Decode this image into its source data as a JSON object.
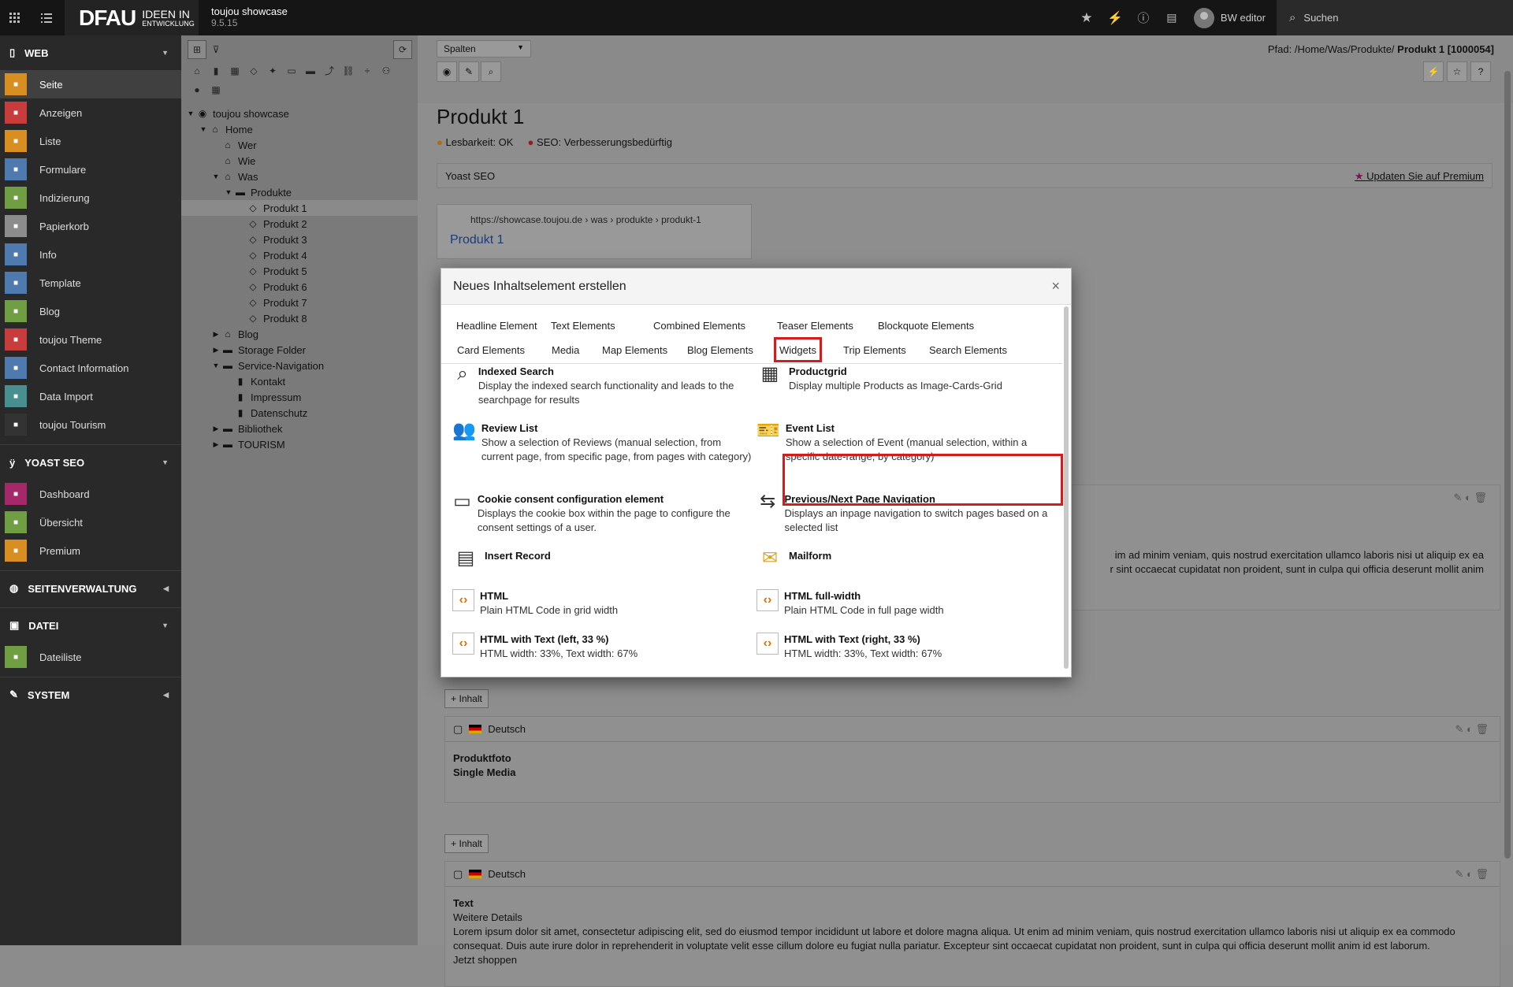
{
  "topbar": {
    "logo_main": "DFAU",
    "logo_sub1": "IDEEN IN",
    "logo_sub2": "ENTWICKLUNG",
    "site_name": "toujou showcase",
    "version": "9.5.15",
    "user": "BW editor",
    "search_placeholder": "Suchen"
  },
  "modules": {
    "web_label": "WEB",
    "web_items": [
      {
        "label": "Seite",
        "color": "#d98e21",
        "icon": "page-icon"
      },
      {
        "label": "Anzeigen",
        "color": "#c83c3c",
        "icon": "eye-icon"
      },
      {
        "label": "Liste",
        "color": "#d98e21",
        "icon": "list-icon"
      },
      {
        "label": "Formulare",
        "color": "#4f7ab0",
        "icon": "form-icon"
      },
      {
        "label": "Indizierung",
        "color": "#6f9e43",
        "icon": "index-icon"
      },
      {
        "label": "Papierkorb",
        "color": "#8c8c8c",
        "icon": "trash-icon"
      },
      {
        "label": "Info",
        "color": "#4f7ab0",
        "icon": "info-icon"
      },
      {
        "label": "Template",
        "color": "#4f7ab0",
        "icon": "template-icon"
      },
      {
        "label": "Blog",
        "color": "#6f9e43",
        "icon": "blog-icon"
      },
      {
        "label": "toujou Theme",
        "color": "#c83c3c",
        "icon": "fingerprint-icon"
      },
      {
        "label": "Contact Information",
        "color": "#4f7ab0",
        "icon": "contact-icon"
      },
      {
        "label": "Data Import",
        "color": "#4a8f8f",
        "icon": "cloud-icon"
      },
      {
        "label": "toujou Tourism",
        "color": "#333333",
        "icon": "plane-icon"
      }
    ],
    "yoast_label": "YOAST SEO",
    "yoast_items": [
      {
        "label": "Dashboard",
        "color": "#a4286a",
        "icon": "dashboard-icon"
      },
      {
        "label": "Übersicht",
        "color": "#6f9e43",
        "icon": "overview-icon"
      },
      {
        "label": "Premium",
        "color": "#d98e21",
        "icon": "trophy-icon"
      }
    ],
    "seiten_label": "SEITENVERWALTUNG",
    "datei_label": "DATEI",
    "datei_items": [
      {
        "label": "Dateiliste",
        "color": "#6f9e43",
        "icon": "files-icon"
      }
    ],
    "system_label": "SYSTEM"
  },
  "tree": [
    {
      "label": "toujou showcase",
      "depth": 0,
      "twisty": "▼",
      "icon": "◉"
    },
    {
      "label": "Home",
      "depth": 1,
      "twisty": "▼",
      "icon": "⌂"
    },
    {
      "label": "Wer",
      "depth": 2,
      "twisty": "",
      "icon": "⌂"
    },
    {
      "label": "Wie",
      "depth": 2,
      "twisty": "",
      "icon": "⌂"
    },
    {
      "label": "Was",
      "depth": 2,
      "twisty": "▼",
      "icon": "⌂"
    },
    {
      "label": "Produkte",
      "depth": 3,
      "twisty": "▼",
      "icon": "▬"
    },
    {
      "label": "Produkt 1",
      "depth": 4,
      "twisty": "",
      "icon": "◇",
      "selected": true
    },
    {
      "label": "Produkt 2",
      "depth": 4,
      "twisty": "",
      "icon": "◇"
    },
    {
      "label": "Produkt 3",
      "depth": 4,
      "twisty": "",
      "icon": "◇"
    },
    {
      "label": "Produkt 4",
      "depth": 4,
      "twisty": "",
      "icon": "◇"
    },
    {
      "label": "Produkt 5",
      "depth": 4,
      "twisty": "",
      "icon": "◇"
    },
    {
      "label": "Produkt 6",
      "depth": 4,
      "twisty": "",
      "icon": "◇"
    },
    {
      "label": "Produkt 7",
      "depth": 4,
      "twisty": "",
      "icon": "◇"
    },
    {
      "label": "Produkt 8",
      "depth": 4,
      "twisty": "",
      "icon": "◇"
    },
    {
      "label": "Blog",
      "depth": 2,
      "twisty": "▶",
      "icon": "⌂"
    },
    {
      "label": "Storage Folder",
      "depth": 2,
      "twisty": "▶",
      "icon": "▬"
    },
    {
      "label": "Service-Navigation",
      "depth": 2,
      "twisty": "▼",
      "icon": "▬"
    },
    {
      "label": "Kontakt",
      "depth": 3,
      "twisty": "",
      "icon": "▮"
    },
    {
      "label": "Impressum",
      "depth": 3,
      "twisty": "",
      "icon": "▮"
    },
    {
      "label": "Datenschutz",
      "depth": 3,
      "twisty": "",
      "icon": "▮"
    },
    {
      "label": "Bibliothek",
      "depth": 2,
      "twisty": "▶",
      "icon": "▬"
    },
    {
      "label": "TOURISM",
      "depth": 2,
      "twisty": "▶",
      "icon": "▬"
    }
  ],
  "doc": {
    "view_select": "Spalten",
    "path_label": "Pfad: /Home/Was/Produkte/",
    "path_page": "Produkt 1 [1000054]",
    "title": "Produkt 1",
    "readability": "Lesbarkeit: OK",
    "seo": "SEO: Verbesserungsbedürftig",
    "yoast": "Yoast SEO",
    "premium_link": "Updaten Sie auf Premium",
    "snippet_url": "https://showcase.toujou.de › was › produkte › produkt-1",
    "snippet_title": "Produkt 1",
    "lorem1": "im ad minim veniam, quis nostrud exercitation ullamco laboris nisi ut aliquip ex ea",
    "lorem2": "r sint occaecat cupidatat non proident, sunt in culpa qui officia deserunt mollit anim",
    "add_content": "Inhalt",
    "lang": "Deutsch",
    "block1_l1": "Produktfoto",
    "block1_l2": "Single Media",
    "block2_title": "Text",
    "block2_sub": "Weitere Details",
    "block2_body": "Lorem ipsum dolor sit amet, consectetur adipiscing elit, sed do eiusmod tempor incididunt ut labore et dolore magna aliqua. Ut enim ad minim veniam, quis nostrud exercitation ullamco laboris nisi ut aliquip ex ea commodo consequat. Duis aute irure dolor in reprehenderit in voluptate velit esse cillum dolore eu fugiat nulla pariatur. Excepteur sint occaecat cupidatat non proident, sunt in culpa qui officia deserunt mollit anim id est laborum.",
    "block2_more": "Jetzt shoppen"
  },
  "modal": {
    "title": "Neues Inhaltselement erstellen",
    "tabs_row1": [
      "Headline Element",
      "Text Elements",
      "Combined Elements",
      "Teaser Elements",
      "Blockquote Elements"
    ],
    "tabs_row2": [
      "Card Elements",
      "Media",
      "Map Elements",
      "Blog Elements",
      "Widgets",
      "Trip Elements",
      "Search Elements"
    ],
    "active_tab": "Widgets",
    "items": [
      {
        "title": "Indexed Search",
        "desc": "Display the indexed search functionality and leads to the searchpage for results",
        "icon": "search-icon",
        "glyph": "⌕"
      },
      {
        "title": "Productgrid",
        "desc": "Display multiple Products as Image-Cards-Grid",
        "icon": "grid-icon",
        "glyph": "▦"
      },
      {
        "title": "Review List",
        "desc": "Show a selection of Reviews (manual selection, from current page, from specific page, from pages with category)",
        "icon": "reviewers-icon",
        "glyph": "👥"
      },
      {
        "title": "Event List",
        "desc": "Show a selection of Event (manual selection, within a specific date-range, by category)",
        "icon": "ticket-icon",
        "glyph": "🎫"
      },
      {
        "title": "Cookie consent configuration element",
        "desc": "Displays the cookie box within the page to configure the consent settings of a user.",
        "icon": "id-card-icon",
        "glyph": "▭"
      },
      {
        "title": "Previous/Next Page Navigation",
        "desc": "Displays an inpage navigation to switch pages based on a selected list",
        "icon": "page-nav-icon",
        "glyph": "⇆"
      },
      {
        "title": "Insert Record",
        "desc": "",
        "icon": "insert-record-icon",
        "glyph": "▤"
      },
      {
        "title": "Mailform",
        "desc": "",
        "icon": "mail-icon",
        "glyph": "✉"
      },
      {
        "title": "HTML",
        "desc": "Plain HTML Code in grid width",
        "icon": "html-icon",
        "glyph": "‹›"
      },
      {
        "title": "HTML full-width",
        "desc": "Plain HTML Code in full page width",
        "icon": "html-icon",
        "glyph": "‹›"
      },
      {
        "title": "HTML with Text (left, 33 %)",
        "desc": "HTML width: 33%, Text width: 67%",
        "icon": "html-icon",
        "glyph": "‹›"
      },
      {
        "title": "HTML with Text (right, 33 %)",
        "desc": "HTML width: 33%, Text width: 67%",
        "icon": "html-icon",
        "glyph": "‹›"
      }
    ]
  }
}
